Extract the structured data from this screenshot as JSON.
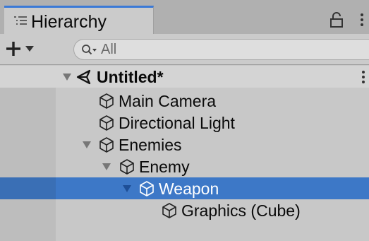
{
  "window": {
    "tab_title": "Hierarchy",
    "tab_icon": "list-icon",
    "lock_icon": "lock-icon",
    "menu_icon": "kebab-menu-icon"
  },
  "toolbar": {
    "add_icon": "plus-icon",
    "add_dropdown_icon": "chevron-down-icon",
    "search_icon": "search-icon",
    "search_placeholder": "All",
    "search_value": ""
  },
  "colors": {
    "accent_tab": "#3a79d6",
    "selection": "#3d78c7",
    "background": "#c8c8c8"
  },
  "tree": {
    "scene": {
      "label": "Untitled*",
      "icon": "unity-scene-icon",
      "expanded": true
    },
    "items": [
      {
        "label": "Main Camera",
        "icon": "cube-icon",
        "depth": 1,
        "has_children": false,
        "expanded": false,
        "selected": false
      },
      {
        "label": "Directional Light",
        "icon": "cube-icon",
        "depth": 1,
        "has_children": false,
        "expanded": false,
        "selected": false
      },
      {
        "label": "Enemies",
        "icon": "cube-icon",
        "depth": 1,
        "has_children": true,
        "expanded": true,
        "selected": false
      },
      {
        "label": "Enemy",
        "icon": "cube-icon",
        "depth": 2,
        "has_children": true,
        "expanded": true,
        "selected": false
      },
      {
        "label": "Weapon",
        "icon": "cube-icon",
        "depth": 3,
        "has_children": true,
        "expanded": true,
        "selected": true
      },
      {
        "label": "Graphics (Cube)",
        "icon": "cube-icon",
        "depth": 4,
        "has_children": false,
        "expanded": false,
        "selected": false
      }
    ]
  }
}
